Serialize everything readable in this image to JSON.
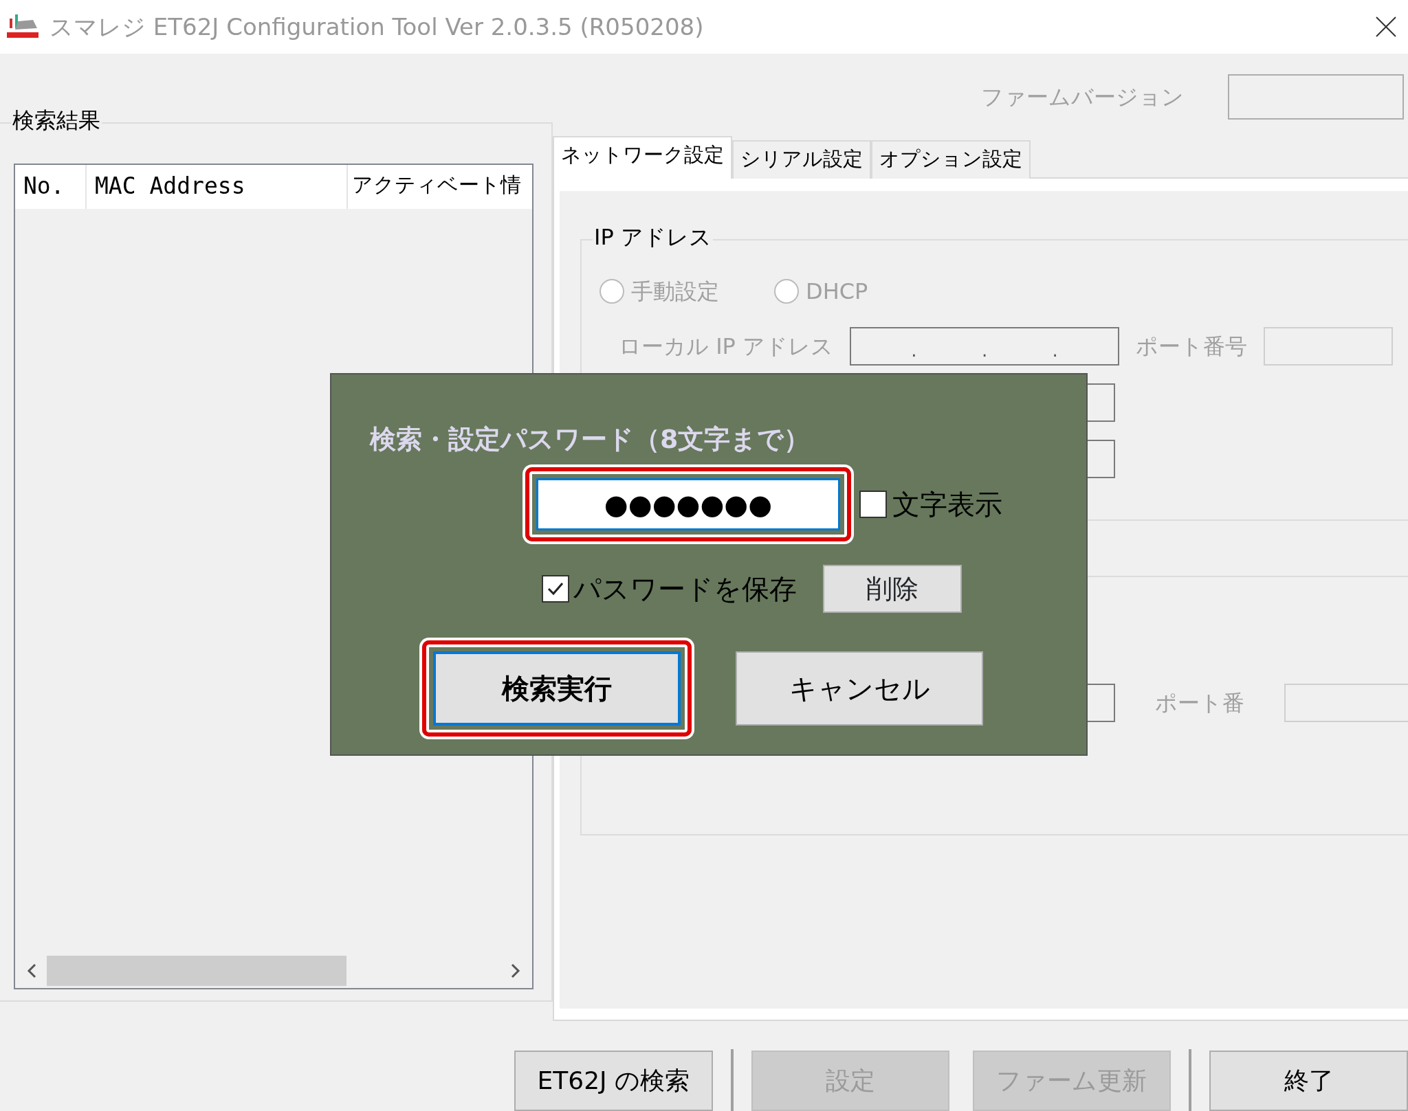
{
  "window": {
    "title": "スマレジ ET62J Configuration Tool  Ver 2.0.3.5 (R050208)"
  },
  "firmware": {
    "label": "ファームバージョン"
  },
  "results": {
    "title": "検索結果",
    "columns": [
      "No.",
      "MAC Address",
      "アクティベート情"
    ]
  },
  "tabs": [
    {
      "label": "ネットワーク設定",
      "selected": true
    },
    {
      "label": "シリアル設定",
      "selected": false
    },
    {
      "label": "オプション設定",
      "selected": false
    }
  ],
  "ip_group": {
    "title": "IP アドレス",
    "radios": [
      {
        "label": "手動設定",
        "selected": false
      },
      {
        "label": "DHCP",
        "selected": false
      }
    ],
    "local_ip_label": "ローカル IP アドレス",
    "ip_dots": [
      ".",
      ".",
      "."
    ],
    "port_label": "ポート番号"
  },
  "second_group": {
    "port_label": "ポート番"
  },
  "dialog": {
    "title": "検索・設定パスワード（8文字まで）",
    "password": {
      "value": "●●●●●●●",
      "highlighted": true
    },
    "show_chars": {
      "label": "文字表示",
      "checked": false
    },
    "save_password": {
      "label": "パスワードを保存",
      "checked": true
    },
    "delete_button": "削除",
    "buttons": [
      {
        "label": "検索実行",
        "default": true,
        "highlighted": true
      },
      {
        "label": "キャンセル",
        "default": false,
        "highlighted": false
      }
    ]
  },
  "bottom_buttons": [
    {
      "label": "ET62J の検索",
      "disabled": false,
      "group_start": false
    },
    {
      "label": "設定",
      "disabled": true,
      "group_start": true
    },
    {
      "label": "ファーム更新",
      "disabled": true,
      "group_start": false
    },
    {
      "label": "終了",
      "disabled": false,
      "group_start": true
    }
  ]
}
